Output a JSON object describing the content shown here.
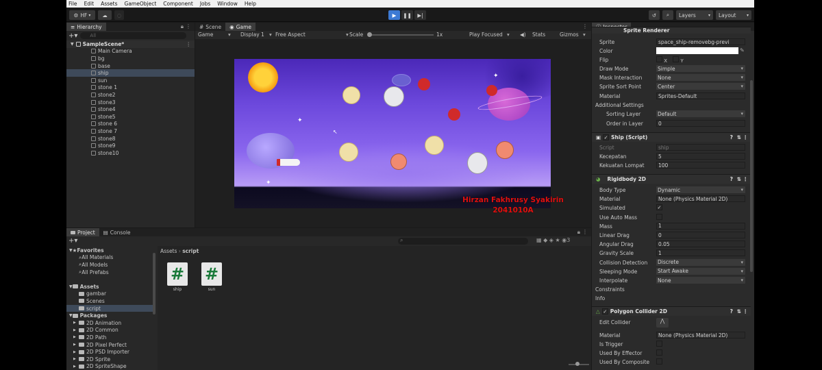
{
  "menu": [
    "File",
    "Edit",
    "Assets",
    "GameObject",
    "Component",
    "Jobs",
    "Window",
    "Help"
  ],
  "toolbar": {
    "account": "HF",
    "layers": "Layers",
    "layout": "Layout"
  },
  "hierarchy": {
    "tab": "Hierarchy",
    "search_placeholder": "All",
    "scene": "SampleScene*",
    "items": [
      "Main Camera",
      "bg",
      "base",
      "ship",
      "sun",
      "stone 1",
      "stone2",
      "stone3",
      "stone4",
      "stone5",
      "stone 6",
      "stone 7",
      "stone8",
      "stone9",
      "stone10"
    ],
    "selected": "ship"
  },
  "game": {
    "tabs": [
      "Scene",
      "Game"
    ],
    "toolbar": {
      "mode": "Game",
      "display": "Display 1",
      "aspect": "Free Aspect",
      "scale_label": "Scale",
      "scale_value": "1x",
      "play": "Play Focused",
      "stats": "Stats",
      "gizmos": "Gizmos"
    },
    "watermark_name": "Hirzan Fakhrusy Syakirin",
    "watermark_id": "2041010A"
  },
  "project": {
    "tabs": [
      "Project",
      "Console"
    ],
    "favorites_label": "Favorites",
    "favorites": [
      "All Materials",
      "All Models",
      "All Prefabs"
    ],
    "assets_label": "Assets",
    "assets": [
      "gambar",
      "Scenes",
      "script"
    ],
    "packages_label": "Packages",
    "packages": [
      "2D Animation",
      "2D Common",
      "2D Path",
      "2D Pixel Perfect",
      "2D PSD Importer",
      "2D Sprite",
      "2D SpriteShape"
    ],
    "breadcrumb": [
      "Assets",
      "script"
    ],
    "files": [
      "ship",
      "sun"
    ]
  },
  "inspector": {
    "tab": "Inspector",
    "sprite_renderer": {
      "title": "Sprite Renderer",
      "sprite_label": "Sprite",
      "sprite_value": "space_ship-removebg-previ",
      "color_label": "Color",
      "flip_label": "Flip",
      "flip_x": "X",
      "flip_y": "Y",
      "draw_mode_label": "Draw Mode",
      "draw_mode_value": "Simple",
      "mask_label": "Mask Interaction",
      "mask_value": "None",
      "sort_point_label": "Sprite Sort Point",
      "sort_point_value": "Center",
      "material_label": "Material",
      "material_value": "Sprites-Default",
      "additional_label": "Additional Settings",
      "sorting_layer_label": "Sorting Layer",
      "sorting_layer_value": "Default",
      "order_label": "Order in Layer",
      "order_value": "0"
    },
    "ship_script": {
      "title": "Ship (Script)",
      "script_label": "Script",
      "script_value": "ship",
      "speed_label": "Kecepatan",
      "speed_value": "5",
      "jump_label": "Kekuatan Lompat",
      "jump_value": "100"
    },
    "rigidbody": {
      "title": "Rigidbody 2D",
      "body_type_label": "Body Type",
      "body_type_value": "Dynamic",
      "material_label": "Material",
      "material_value": "None (Physics Material 2D)",
      "simulated_label": "Simulated",
      "auto_mass_label": "Use Auto Mass",
      "mass_label": "Mass",
      "mass_value": "1",
      "linear_label": "Linear Drag",
      "linear_value": "0",
      "angular_label": "Angular Drag",
      "angular_value": "0.05",
      "gravity_label": "Gravity Scale",
      "gravity_value": "1",
      "collision_label": "Collision Detection",
      "collision_value": "Discrete",
      "sleep_label": "Sleeping Mode",
      "sleep_value": "Start Awake",
      "interp_label": "Interpolate",
      "interp_value": "None",
      "constraints_label": "Constraints",
      "info_label": "Info"
    },
    "collider": {
      "title": "Polygon Collider 2D",
      "edit_label": "Edit Collider",
      "material_label": "Material",
      "material_value": "None (Physics Material 2D)",
      "trigger_label": "Is Trigger",
      "effector_label": "Used By Effector",
      "composite_label": "Used By Composite"
    }
  },
  "colors": {
    "accent_blue": "#3d7ad4",
    "watermark_red": "#e01010",
    "sky_purple": "#5a3ad0"
  }
}
